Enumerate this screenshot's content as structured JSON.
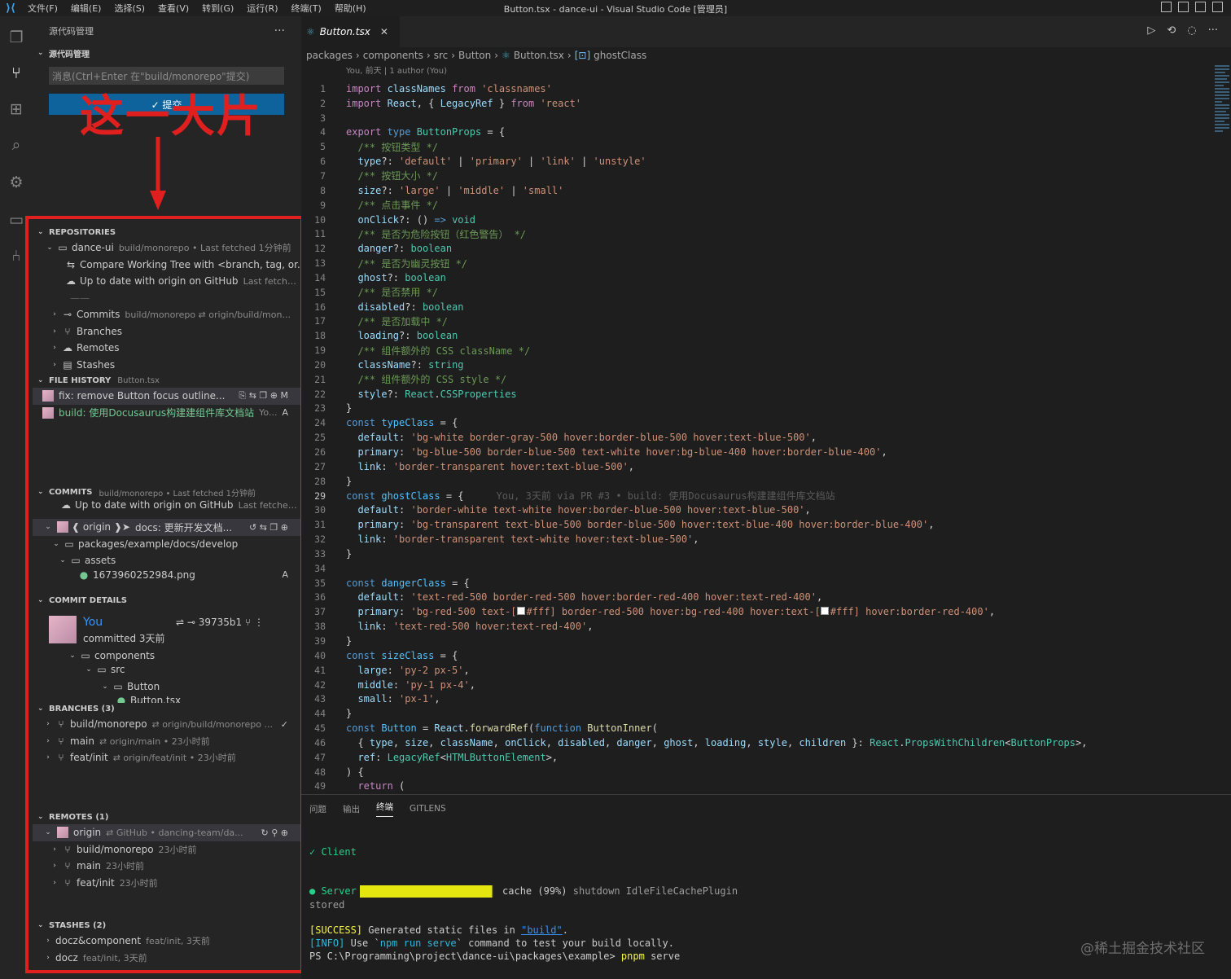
{
  "titlebar": {
    "menus": [
      "文件(F)",
      "编辑(E)",
      "选择(S)",
      "查看(V)",
      "转到(G)",
      "运行(R)",
      "终端(T)",
      "帮助(H)"
    ],
    "title": "Button.tsx - dance-ui - Visual Studio Code [管理员]"
  },
  "sidebar": {
    "header": "源代码管理",
    "scm_section": "源代码管理",
    "message_placeholder": "消息(Ctrl+Enter 在\"build/monorepo\"提交)",
    "commit_button": "✓ 提交",
    "annotation": "这一大片",
    "repositories": {
      "title": "REPOSITORIES",
      "repo_name": "dance-ui",
      "repo_desc": "build/monorepo • Last fetched 1分钟前",
      "compare": "Compare Working Tree with <branch, tag, or...",
      "uptodate": "Up to date with origin on GitHub",
      "uptodate_desc": "Last fetche...",
      "commits": "Commits",
      "commits_desc": "build/monorepo ⇄ origin/build/mon...",
      "branches": "Branches",
      "remotes": "Remotes",
      "stashes": "Stashes"
    },
    "file_history": {
      "title": "FILE HISTORY",
      "desc": "Button.tsx",
      "items": [
        {
          "label": "fix: remove Button focus outline...",
          "status": "M"
        },
        {
          "label": "build: 使用Docusaurus构建建组件库文档站",
          "desc": "Yo...",
          "status": "A"
        }
      ]
    },
    "commits": {
      "title": "COMMITS",
      "desc": "build/monorepo • Last fetched 1分钟前",
      "uptodate": "Up to date with origin on GitHub",
      "uptodate_desc": "Last fetched ...",
      "commit_label": "❰ origin ❱➤",
      "commit_msg": "docs: 更新开发文档...",
      "folder1": "packages/example/docs/develop",
      "folder2": "assets",
      "file": "1673960252984.png",
      "file_status": "A"
    },
    "commit_details": {
      "title": "COMMIT DETAILS",
      "author": "You",
      "when": "committed 3天前",
      "sha": "39735b1",
      "folder1": "components",
      "folder2": "src",
      "folder3": "Button",
      "file": "Button.tsx"
    },
    "branches": {
      "title": "BRANCHES (3)",
      "items": [
        {
          "name": "build/monorepo",
          "desc": "⇄ origin/build/monorepo ...",
          "tail": "✓"
        },
        {
          "name": "main",
          "desc": "⇄ origin/main • 23小时前",
          "tail": ""
        },
        {
          "name": "feat/init",
          "desc": "⇄ origin/feat/init • 23小时前",
          "tail": ""
        }
      ]
    },
    "remotes": {
      "title": "REMOTES (1)",
      "origin": "origin",
      "origin_desc": "⇄ GitHub • dancing-team/da...",
      "items": [
        {
          "name": "build/monorepo",
          "desc": "23小时前"
        },
        {
          "name": "main",
          "desc": "23小时前"
        },
        {
          "name": "feat/init",
          "desc": "23小时前"
        }
      ]
    },
    "stashes": {
      "title": "STASHES (2)",
      "items": [
        {
          "name": "docz&component",
          "desc": "feat/init, 3天前"
        },
        {
          "name": "docz",
          "desc": "feat/init, 3天前"
        }
      ]
    }
  },
  "editor": {
    "tab": "Button.tsx",
    "breadcrumb": [
      "packages",
      "components",
      "src",
      "Button",
      "Button.tsx",
      "ghostClass"
    ],
    "blame_header": "You, 前天 | 1 author (You)",
    "current_line": 29,
    "inline_blame": "You, 3天前 via PR #3 • build: 使用Docusaurus构建建组件库文档站"
  },
  "panel": {
    "tabs": [
      "问题",
      "输出",
      "终端",
      "GITLENS"
    ],
    "active_tab": "终端",
    "client": "✓ Client",
    "server_label": "● Server",
    "server_progress": 0.99,
    "server_status": "cache (99%)",
    "server_detail": "shutdown IdleFileCachePlugin",
    "stored": "stored",
    "success_tag": "[SUCCESS]",
    "success_msg": "Generated static files in ",
    "build_dir": "\"build\"",
    "success_end": ".",
    "info_tag": "[INFO]",
    "info_msg_1": "Use `",
    "info_cmd": "npm run serve",
    "info_msg_2": "` command to test your build locally.",
    "prompt": "PS C:\\Programming\\project\\dance-ui\\packages\\example>",
    "command": "pnpm",
    "command_arg": "serve",
    "watermark": "@稀土掘金技术社区"
  },
  "colors": {
    "accent": "#0e639c",
    "annotation_red": "#e01f1f",
    "progress_yellow": "#e5e510"
  }
}
